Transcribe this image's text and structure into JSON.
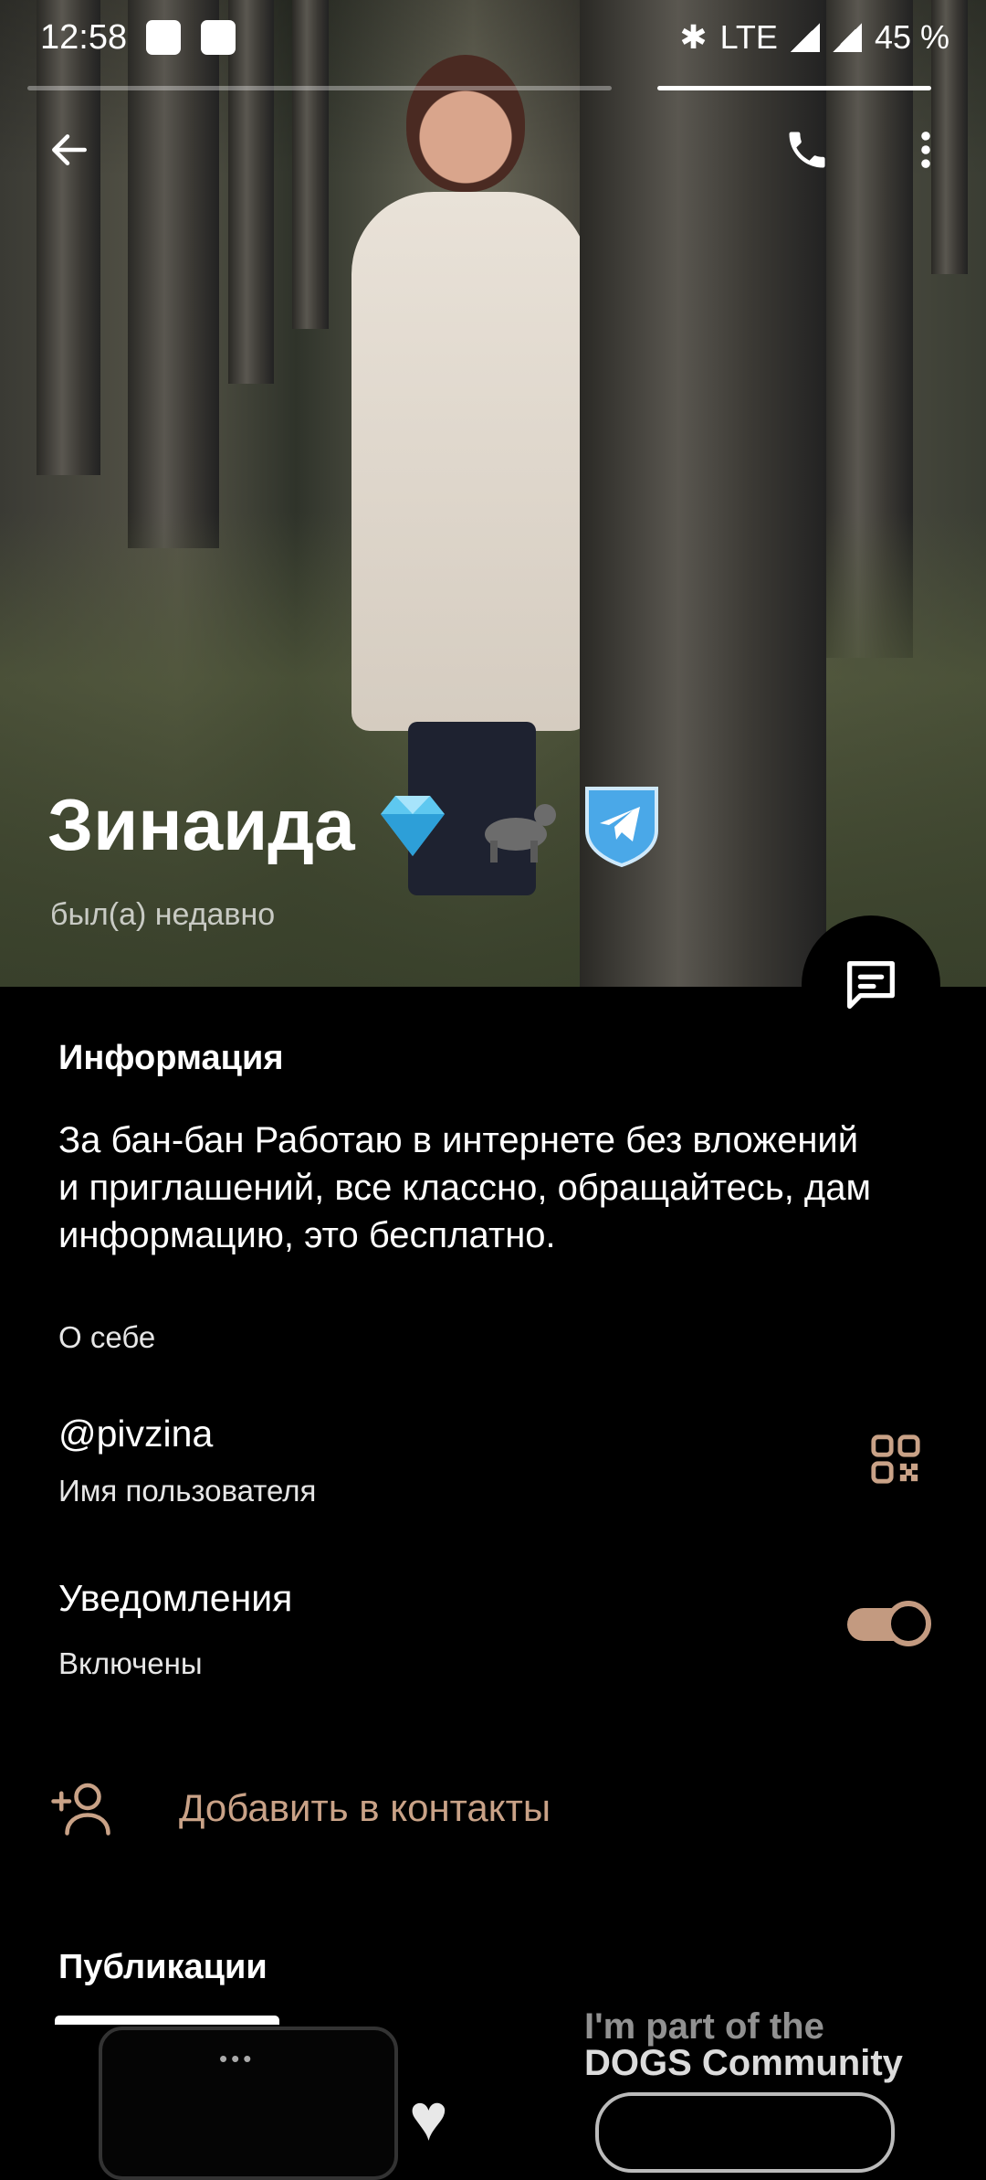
{
  "status_bar": {
    "time": "12:58",
    "network": "LTE",
    "battery": "45 %"
  },
  "profile": {
    "name": "Зинаида",
    "last_seen": "был(а) недавно"
  },
  "info": {
    "section_title": "Информация",
    "bio": "За бан-бан Работаю в интернете без вложений и приглашений, все классно, обращайтесь, дам информацию, это бесплатно.",
    "bio_label": "О себе",
    "username": "@pivzina",
    "username_label": "Имя пользователя",
    "notifications_title": "Уведомления",
    "notifications_status": "Включены",
    "notifications_enabled": true
  },
  "actions": {
    "add_contact": "Добавить в контакты"
  },
  "posts": {
    "section_title": "Публикации",
    "preview_caption_top": "I'm part of the",
    "preview_caption": "DOGS Community"
  },
  "colors": {
    "accent": "#c9a287",
    "background": "#000000",
    "verified_blue": "#4aa8e8"
  }
}
